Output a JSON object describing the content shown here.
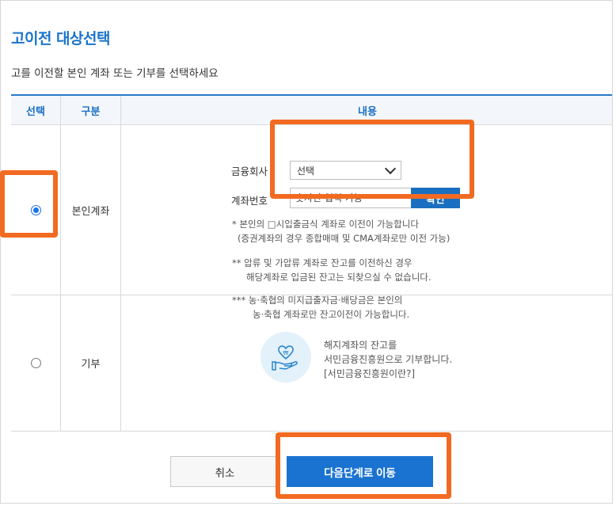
{
  "page": {
    "title": "고이전 대상선택",
    "subtitle": "고를 이전할 본인 계좌 또는 기부를 선택하세요"
  },
  "table": {
    "headers": {
      "select": "선택",
      "category": "구분",
      "content": "내용"
    },
    "rows": [
      {
        "category": "본인계좌",
        "selected": true,
        "form": {
          "company_label": "금융회사",
          "company_value": "선택",
          "account_label": "계좌번호",
          "account_placeholder": "숫자만 입력 가능",
          "confirm_label": "확인"
        },
        "notes": [
          "* 본인의 □시입출금식 계좌로 이전이 가능합니다",
          "(증권계좌의 경우 종합매매 및 CMA계좌로만 이전 가능)",
          "** 압류 및 가압류 계좌로 잔고를 이전하신 경우",
          "해당계좌로 입금된 잔고는 되찾으실 수 없습니다.",
          "*** 농·축협의 미지급출자금·배당금은 본인의",
          "농·축협 계좌로만 잔고이전이 가능합니다."
        ]
      },
      {
        "category": "기부",
        "selected": false,
        "donate": {
          "line1": "해지계좌의 잔고를",
          "line2": "서민금융진흥원으로 기부합니다.",
          "link": "[서민금융진흥원이란?]",
          "icon": "heart-hand-icon"
        }
      }
    ]
  },
  "buttons": {
    "cancel": "취소",
    "next": "다음단계로 이동"
  },
  "colors": {
    "accent": "#1a73c9",
    "highlight": "#f26a21",
    "icon_bg": "#e3f1fb"
  }
}
